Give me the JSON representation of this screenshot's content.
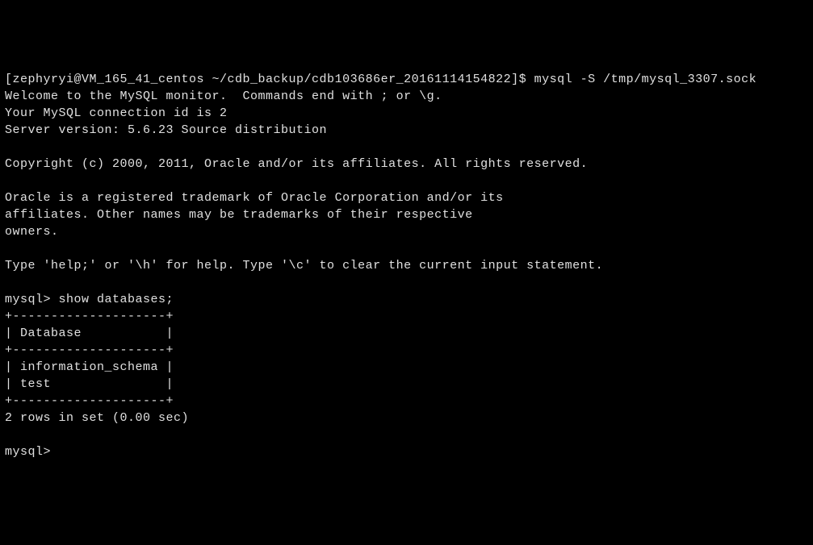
{
  "shell": {
    "prompt": "[zephyryi@VM_165_41_centos ~/cdb_backup/cdb103686er_20161114154822]$ ",
    "command": "mysql -S /tmp/mysql_3307.sock"
  },
  "welcome": {
    "line1": "Welcome to the MySQL monitor.  Commands end with ; or \\g.",
    "line2": "Your MySQL connection id is 2",
    "line3": "Server version: 5.6.23 Source distribution"
  },
  "copyright": "Copyright (c) 2000, 2011, Oracle and/or its affiliates. All rights reserved.",
  "trademark": {
    "line1": "Oracle is a registered trademark of Oracle Corporation and/or its",
    "line2": "affiliates. Other names may be trademarks of their respective",
    "line3": "owners."
  },
  "help": "Type 'help;' or '\\h' for help. Type '\\c' to clear the current input statement.",
  "mysql": {
    "prompt1": "mysql> ",
    "command1": "show databases;",
    "prompt2": "mysql> "
  },
  "table": {
    "border": "+--------------------+",
    "header": "| Database           |",
    "row1": "| information_schema |",
    "row2": "| test               |"
  },
  "result": "2 rows in set (0.00 sec)"
}
